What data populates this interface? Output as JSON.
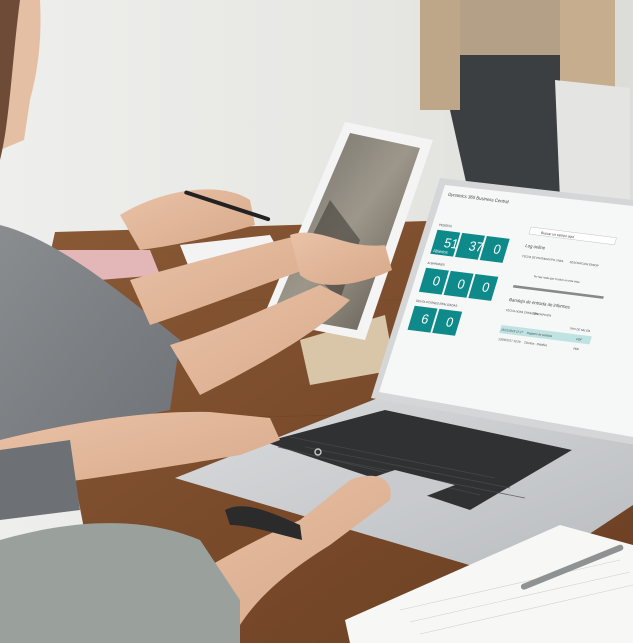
{
  "scene": {
    "description_kind": "photo",
    "subjects": [
      "woman-typing-on-laptop",
      "person-holding-tablet",
      "person-writing",
      "standing-person"
    ]
  },
  "laptop_screen": {
    "app_title": "Dynamics 365 Business Central",
    "search_placeholder": "Buscar un campo aquí",
    "section_pedidos": "PEDIDOS",
    "section_albaranes": "ALBARANES",
    "section_devoluciones": "DEVOLUCIONES REALIZADAS",
    "tiles_row1": [
      {
        "value": "51",
        "label": "Abiertos"
      },
      {
        "value": "37",
        "label": "Pendientes de enviar"
      },
      {
        "value": "0",
        "label": "Demorados"
      }
    ],
    "tiles_row2": [
      {
        "value": "0",
        "label": "Pedidos pendientes"
      },
      {
        "value": "0",
        "label": "Registro de pedido"
      },
      {
        "value": "0",
        "label": "Pedidos demorados"
      }
    ],
    "tiles_row3": [
      {
        "value": "6",
        "label": "Abiertas"
      },
      {
        "value": "0",
        "label": "Pendientes"
      }
    ],
    "log_panel": {
      "title": "Log online",
      "col1": "FECHA DE ENTRADA",
      "col2": "TIPO LÍNEA",
      "col3": "DESCRIPCIÓN ERROR",
      "empty_text": "No hay nada que mostrar en esta vista"
    },
    "report_panel": {
      "title": "Bandeja de entrada de informes",
      "col1": "FECHA HORA CREACIÓN",
      "col2": "DESCRIPCIÓN",
      "col3": "TIPO DE SALIDA",
      "rows": [
        {
          "date": "15/11/2019 12:27",
          "desc": "Registro de pedidos",
          "type": "PDF"
        },
        {
          "date": "13/09/2017 10:28",
          "desc": "Clientes - Detalles",
          "type": "PDF"
        }
      ]
    }
  }
}
